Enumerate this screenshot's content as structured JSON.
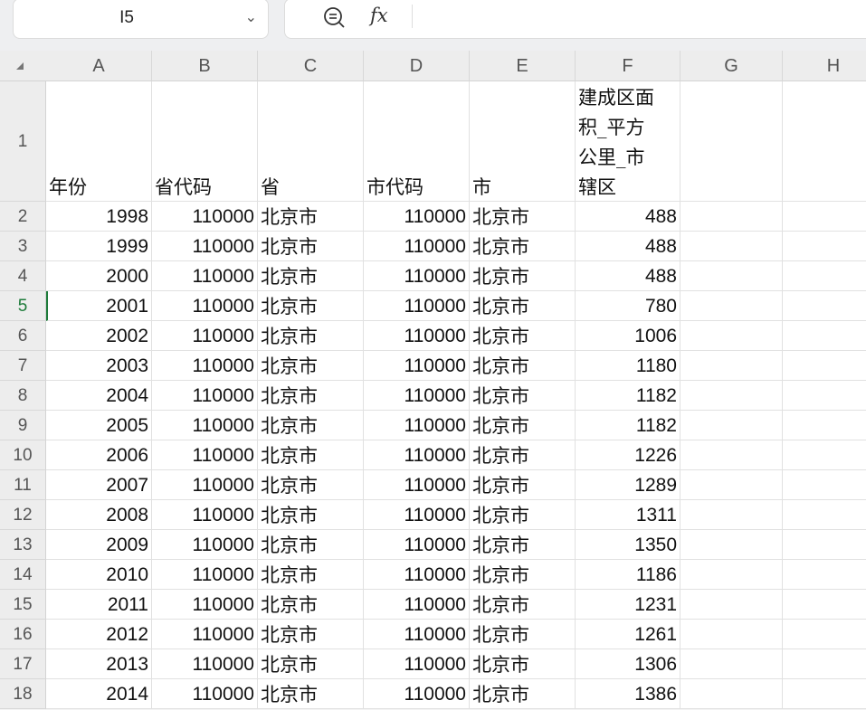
{
  "name_box": {
    "value": "I5"
  },
  "columns": [
    "A",
    "B",
    "C",
    "D",
    "E",
    "F",
    "G",
    "H"
  ],
  "headers": [
    "年份",
    "省代码",
    "省",
    "市代码",
    "市",
    "建成区面积_平方公里_市辖区"
  ],
  "header_f_lines": [
    "建成区面",
    "积_平方",
    "公里_市",
    "辖区"
  ],
  "rows": [
    {
      "n": "2",
      "year": "1998",
      "pcode": "110000",
      "prov": "北京市",
      "ccode": "110000",
      "city": "北京市",
      "area": "488"
    },
    {
      "n": "3",
      "year": "1999",
      "pcode": "110000",
      "prov": "北京市",
      "ccode": "110000",
      "city": "北京市",
      "area": "488"
    },
    {
      "n": "4",
      "year": "2000",
      "pcode": "110000",
      "prov": "北京市",
      "ccode": "110000",
      "city": "北京市",
      "area": "488"
    },
    {
      "n": "5",
      "year": "2001",
      "pcode": "110000",
      "prov": "北京市",
      "ccode": "110000",
      "city": "北京市",
      "area": "780"
    },
    {
      "n": "6",
      "year": "2002",
      "pcode": "110000",
      "prov": "北京市",
      "ccode": "110000",
      "city": "北京市",
      "area": "1006"
    },
    {
      "n": "7",
      "year": "2003",
      "pcode": "110000",
      "prov": "北京市",
      "ccode": "110000",
      "city": "北京市",
      "area": "1180"
    },
    {
      "n": "8",
      "year": "2004",
      "pcode": "110000",
      "prov": "北京市",
      "ccode": "110000",
      "city": "北京市",
      "area": "1182"
    },
    {
      "n": "9",
      "year": "2005",
      "pcode": "110000",
      "prov": "北京市",
      "ccode": "110000",
      "city": "北京市",
      "area": "1182"
    },
    {
      "n": "10",
      "year": "2006",
      "pcode": "110000",
      "prov": "北京市",
      "ccode": "110000",
      "city": "北京市",
      "area": "1226"
    },
    {
      "n": "11",
      "year": "2007",
      "pcode": "110000",
      "prov": "北京市",
      "ccode": "110000",
      "city": "北京市",
      "area": "1289"
    },
    {
      "n": "12",
      "year": "2008",
      "pcode": "110000",
      "prov": "北京市",
      "ccode": "110000",
      "city": "北京市",
      "area": "1311"
    },
    {
      "n": "13",
      "year": "2009",
      "pcode": "110000",
      "prov": "北京市",
      "ccode": "110000",
      "city": "北京市",
      "area": "1350"
    },
    {
      "n": "14",
      "year": "2010",
      "pcode": "110000",
      "prov": "北京市",
      "ccode": "110000",
      "city": "北京市",
      "area": "1186"
    },
    {
      "n": "15",
      "year": "2011",
      "pcode": "110000",
      "prov": "北京市",
      "ccode": "110000",
      "city": "北京市",
      "area": "1231"
    },
    {
      "n": "16",
      "year": "2012",
      "pcode": "110000",
      "prov": "北京市",
      "ccode": "110000",
      "city": "北京市",
      "area": "1261"
    },
    {
      "n": "17",
      "year": "2013",
      "pcode": "110000",
      "prov": "北京市",
      "ccode": "110000",
      "city": "北京市",
      "area": "1306"
    },
    {
      "n": "18",
      "year": "2014",
      "pcode": "110000",
      "prov": "北京市",
      "ccode": "110000",
      "city": "北京市",
      "area": "1386"
    }
  ],
  "active_row": "5",
  "accent": "#1e7b3a"
}
